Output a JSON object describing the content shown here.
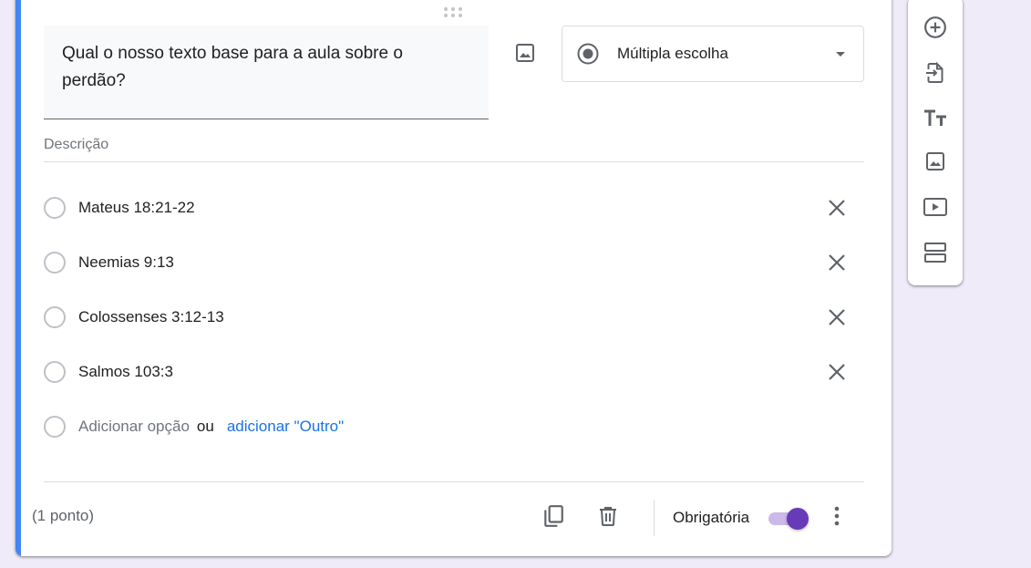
{
  "question": {
    "title": "Qual o nosso texto base para a aula sobre o perdão?",
    "type_label": "Múltipla escolha",
    "description_placeholder": "Descrição"
  },
  "options": [
    {
      "label": "Mateus 18:21-22"
    },
    {
      "label": "Neemias 9:13"
    },
    {
      "label": "Colossenses 3:12-13"
    },
    {
      "label": "Salmos 103:3"
    }
  ],
  "add_option": {
    "add_label": "Adicionar opção",
    "or_label": "ou",
    "add_other_label": "adicionar \"Outro\""
  },
  "footer": {
    "points": "(1 ponto)",
    "required_label": "Obrigatória",
    "required_on": true
  },
  "toolbar": {
    "items": [
      "add-question-icon",
      "import-questions-icon",
      "add-title-icon",
      "add-image-icon",
      "add-video-icon",
      "add-section-icon"
    ]
  },
  "colors": {
    "accent": "#4285f4",
    "toggle": "#673ab7",
    "link": "#1a73e8",
    "background": "#f0ebf8"
  }
}
